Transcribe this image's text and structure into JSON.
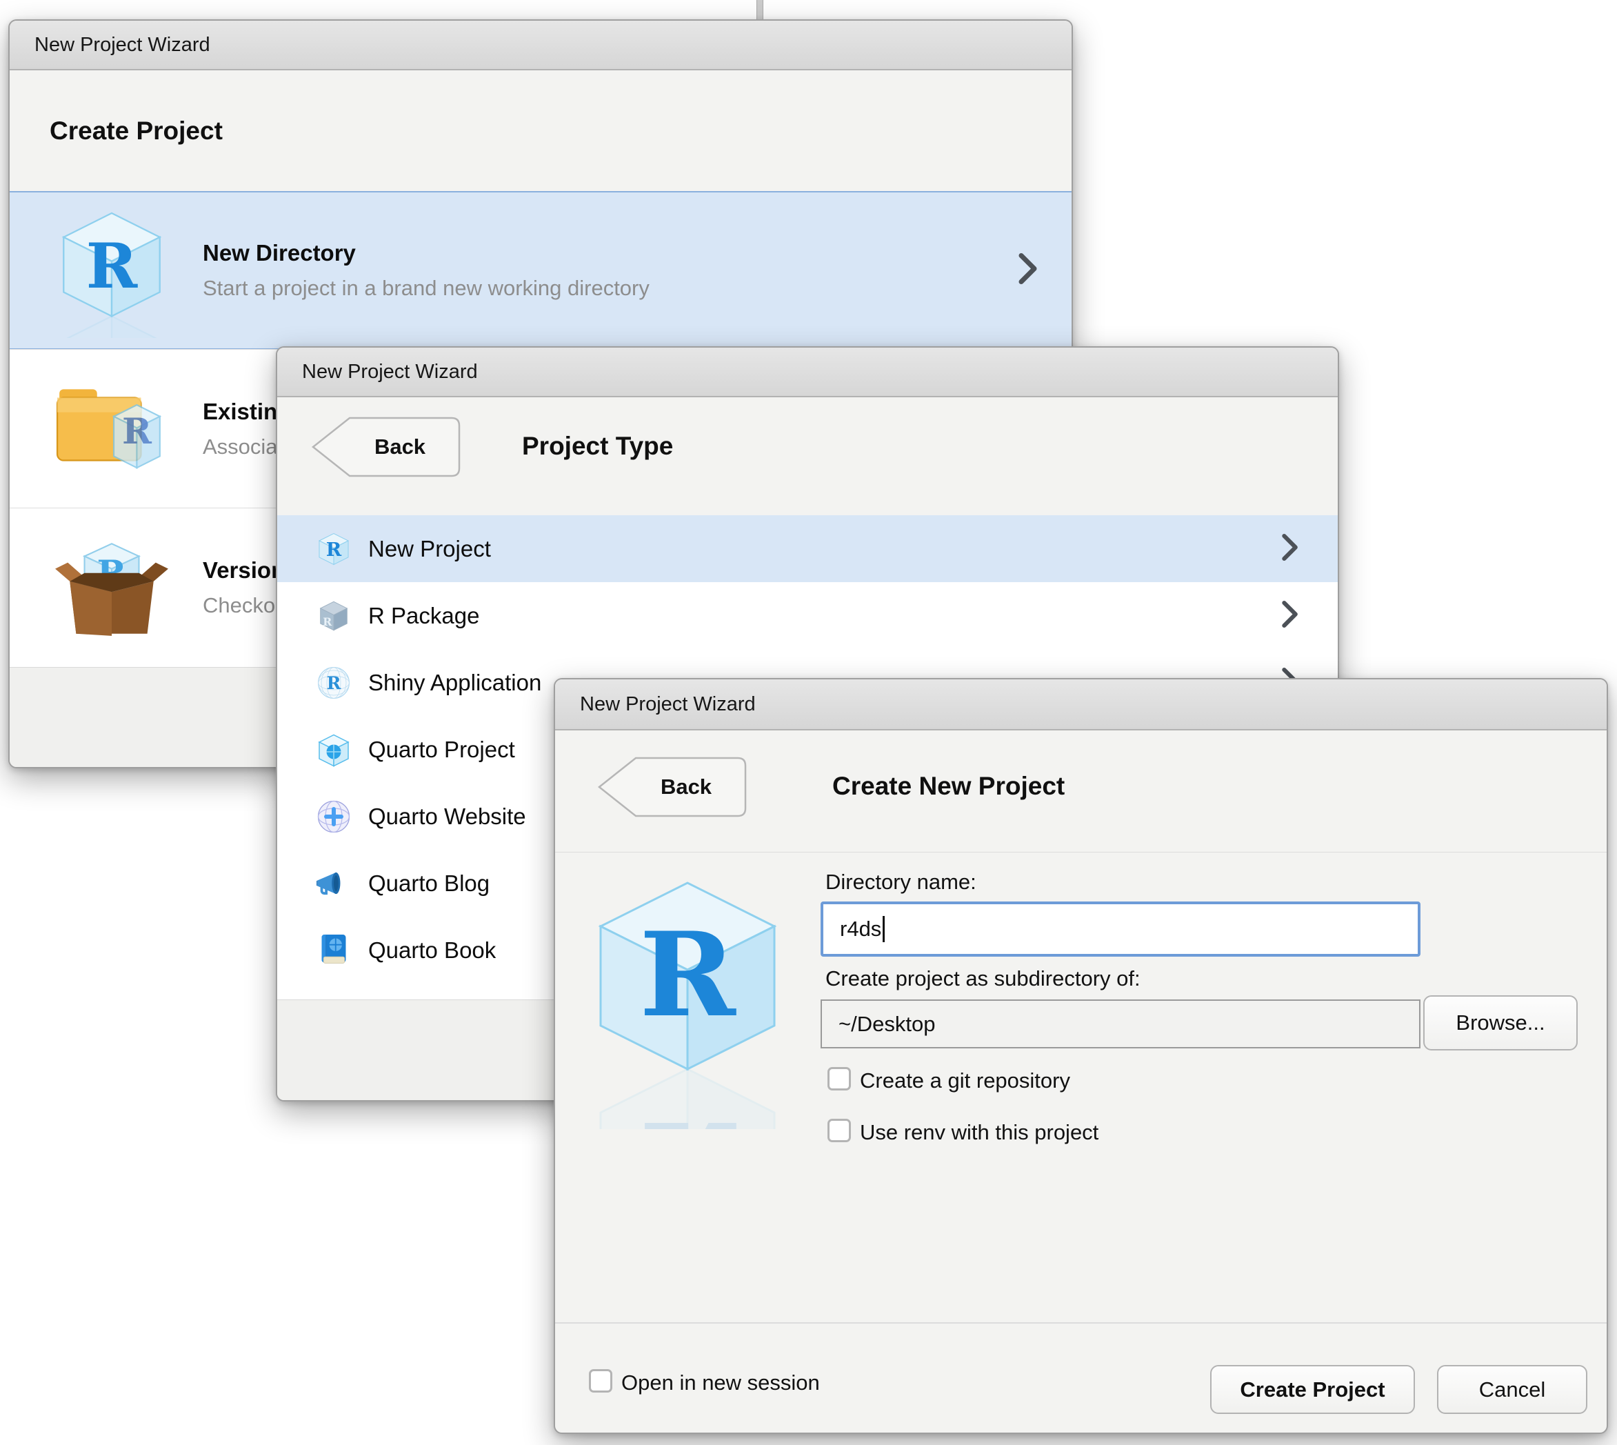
{
  "dialog1": {
    "title": "New Project Wizard",
    "heading": "Create Project",
    "rows": [
      {
        "title": "New Directory",
        "description": "Start a project in a brand new working directory",
        "icon": "r-cube-icon",
        "selected": true
      },
      {
        "title": "Existing Directory",
        "description": "Associate a project with an existing working directory",
        "icon": "folder-r-icon",
        "selected": false
      },
      {
        "title": "Version Control",
        "description": "Checkout a project from a version control repository",
        "icon": "box-r-icon",
        "selected": false
      }
    ]
  },
  "dialog2": {
    "title": "New Project Wizard",
    "back_label": "Back",
    "heading": "Project Type",
    "items": [
      {
        "label": "New Project",
        "icon": "r-cube-icon",
        "selected": true
      },
      {
        "label": "R Package",
        "icon": "r-package-icon",
        "selected": false
      },
      {
        "label": "Shiny Application",
        "icon": "shiny-icon",
        "selected": false
      },
      {
        "label": "Quarto Project",
        "icon": "quarto-project-icon",
        "selected": false
      },
      {
        "label": "Quarto Website",
        "icon": "quarto-website-icon",
        "selected": false
      },
      {
        "label": "Quarto Blog",
        "icon": "quarto-blog-icon",
        "selected": false
      },
      {
        "label": "Quarto Book",
        "icon": "quarto-book-icon",
        "selected": false
      }
    ]
  },
  "dialog3": {
    "title": "New Project Wizard",
    "back_label": "Back",
    "heading": "Create New Project",
    "form": {
      "directory_name_label": "Directory name:",
      "directory_name_value": "r4ds",
      "subdirectory_label": "Create project as subdirectory of:",
      "subdirectory_value": "~/Desktop",
      "browse_label": "Browse...",
      "git_checkbox_label": "Create a git repository",
      "renv_checkbox_label": "Use renv with this project"
    },
    "footer": {
      "open_session_label": "Open in new session",
      "create_label": "Create Project",
      "cancel_label": "Cancel"
    }
  },
  "colors": {
    "selection_blue": "#d8e6f6",
    "selection_border_blue": "#8ab0de",
    "focus_border_blue": "#6d9bd8",
    "titlebar_gray": "#dcdcdc",
    "dialog_background": "#f3f3f1",
    "r_logo_blue": "#1d86d8",
    "description_gray": "#8d8d8d"
  }
}
